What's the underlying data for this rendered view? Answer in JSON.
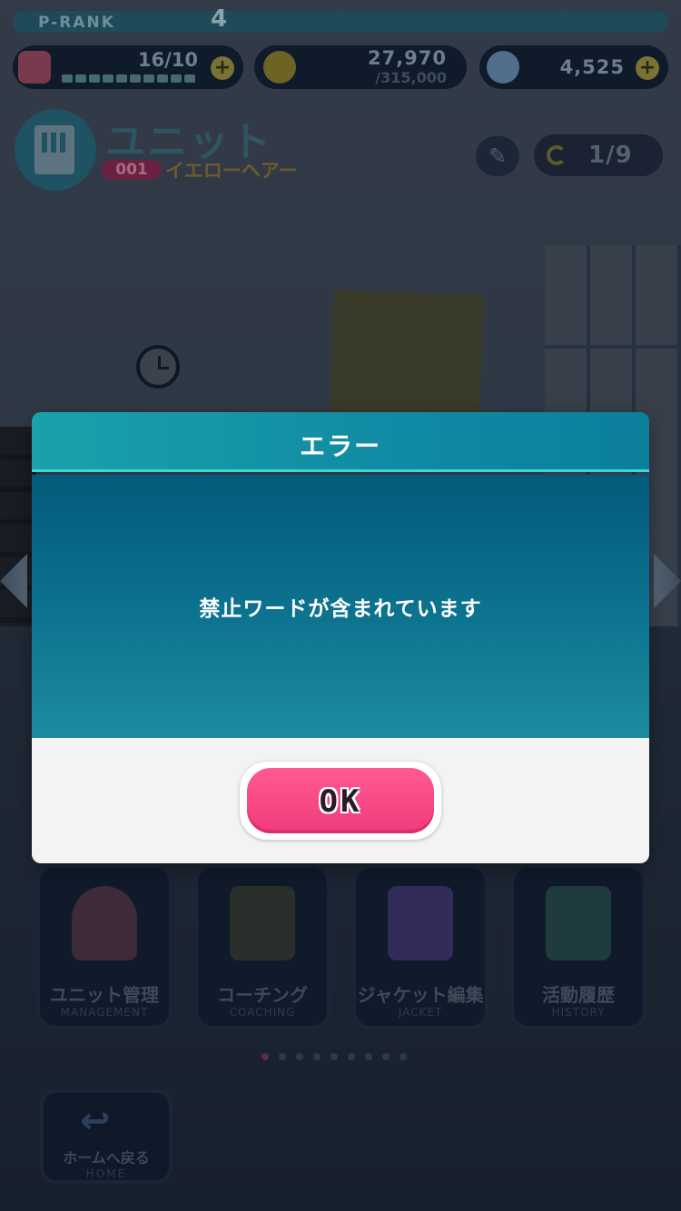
{
  "status": {
    "prank_label": "P-RANK",
    "prank_value": "4",
    "stamina": "16/10",
    "coins": "27,970",
    "coins_max": "/315,000",
    "gems": "4,525"
  },
  "header": {
    "title": "ユニット",
    "unit_number": "001",
    "unit_name": "イエローヘアー",
    "pager": "1/9"
  },
  "menu": [
    {
      "label": "ユニット管理",
      "sub": "MANAGEMENT"
    },
    {
      "label": "コーチング",
      "sub": "COACHING"
    },
    {
      "label": "ジャケット編集",
      "sub": "JACKET"
    },
    {
      "label": "活動履歴",
      "sub": "HISTORY"
    }
  ],
  "home": {
    "label": "ホームへ戻る",
    "sub": "HOME"
  },
  "dialog": {
    "title": "エラー",
    "message": "禁止ワードが含まれています",
    "ok_label": "OK"
  }
}
